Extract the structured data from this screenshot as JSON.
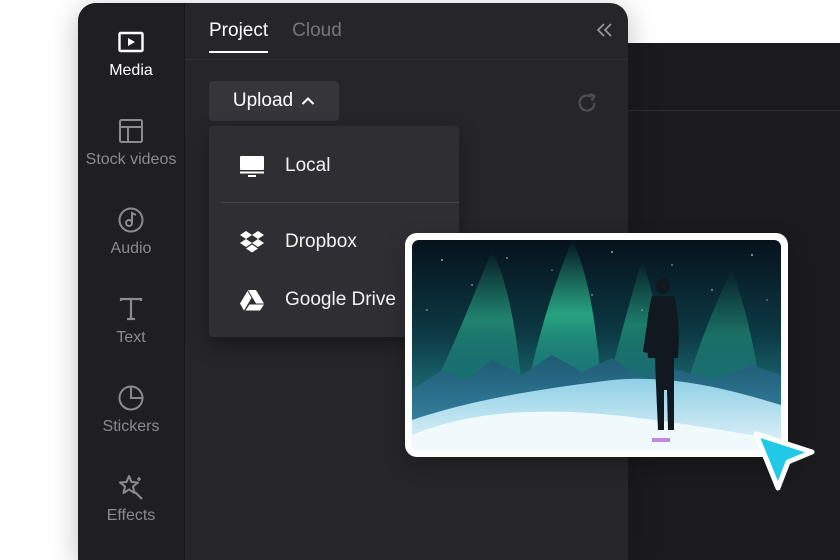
{
  "sidebar": {
    "items": [
      {
        "label": "Media",
        "icon": "media-icon",
        "active": true
      },
      {
        "label": "Stock videos",
        "icon": "stock-videos-icon"
      },
      {
        "label": "Audio",
        "icon": "audio-icon"
      },
      {
        "label": "Text",
        "icon": "text-icon"
      },
      {
        "label": "Stickers",
        "icon": "stickers-icon"
      },
      {
        "label": "Effects",
        "icon": "effects-icon"
      }
    ]
  },
  "tabs": [
    {
      "label": "Project",
      "active": true
    },
    {
      "label": "Cloud"
    }
  ],
  "toolbar": {
    "upload_label": "Upload",
    "icons": [
      "collapse-icon",
      "refresh-icon",
      "chevron-up-icon"
    ]
  },
  "upload_menu": {
    "items": [
      {
        "label": "Local",
        "icon": "monitor-icon"
      },
      {
        "label": "Dropbox",
        "icon": "dropbox-icon"
      },
      {
        "label": "Google Drive",
        "icon": "google-drive-icon"
      }
    ]
  },
  "colors": {
    "panel": "#262629",
    "sidebar": "#1f1f22",
    "menu": "#2f2f33",
    "accent_cursor": "#22c9e6"
  }
}
